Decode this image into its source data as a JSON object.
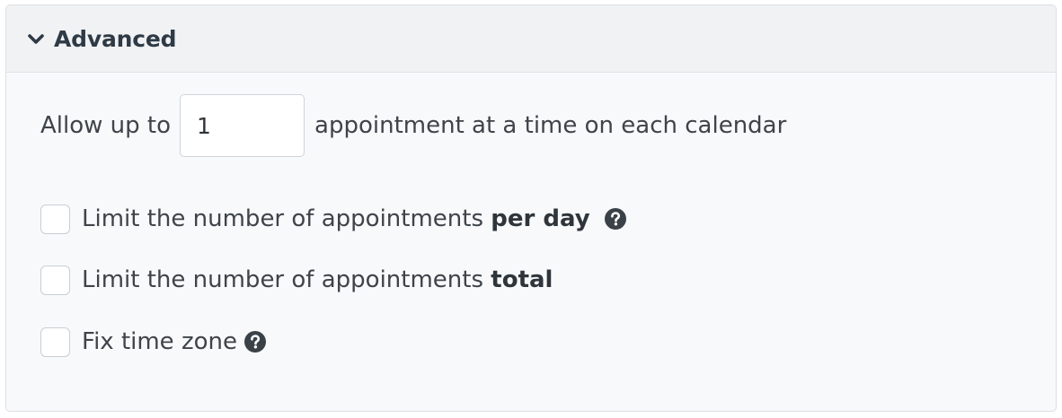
{
  "section": {
    "title": "Advanced"
  },
  "concurrency": {
    "prefix": "Allow up to",
    "value": "1",
    "suffix": "appointment at a time on each calendar"
  },
  "options": [
    {
      "text": "Limit the number of appointments ",
      "bold": "per day",
      "checked": false,
      "help": true
    },
    {
      "text": "Limit the number of appointments ",
      "bold": "total",
      "checked": false,
      "help": false
    },
    {
      "text": "Fix time zone",
      "bold": "",
      "checked": false,
      "help": true
    }
  ],
  "icons": {
    "header": "chevron-down-icon",
    "help": "question-circle-icon"
  },
  "colors": {
    "text": "#3e4449",
    "icon": "#3a4248",
    "border": "#dcdfe3",
    "header_bg": "#f1f2f4",
    "body_bg": "#f8f9fb"
  }
}
